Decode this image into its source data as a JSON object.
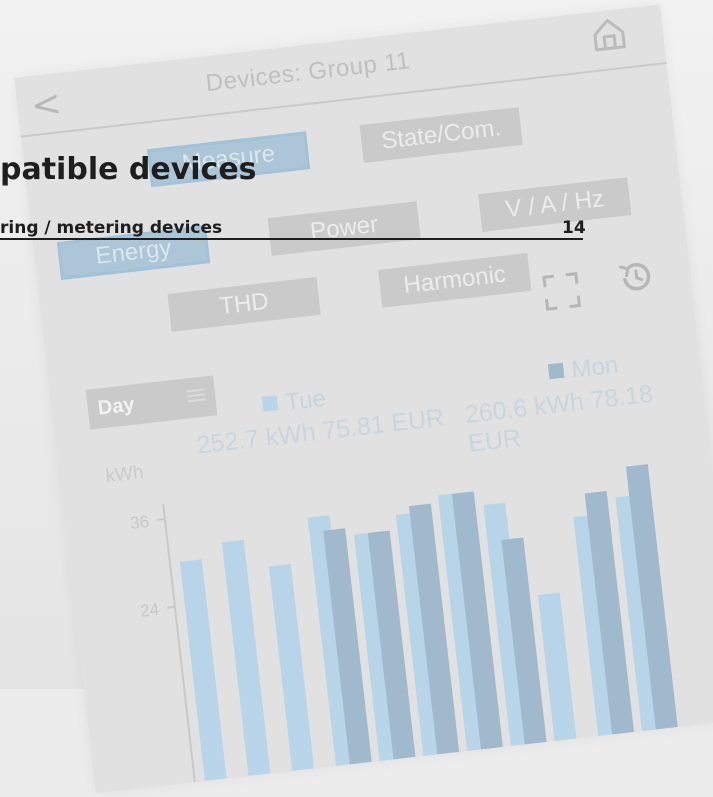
{
  "screen": {
    "title": "Devices: Group 11",
    "back_icon": "chevron-left-icon",
    "home_icon": "home-icon"
  },
  "categories": [
    {
      "label": "Measure",
      "active": true
    },
    {
      "label": "State/Com.",
      "active": false
    }
  ],
  "subtabs": [
    {
      "label": "Energy",
      "active": true
    },
    {
      "label": "Power",
      "active": false
    },
    {
      "label": "V / A / Hz",
      "active": false
    },
    {
      "label": "THD",
      "active": false
    },
    {
      "label": "Harmonic",
      "active": false
    }
  ],
  "period": {
    "label": "Day"
  },
  "legend": [
    {
      "label": "Tue",
      "color": "#b6d4e9",
      "summary": "252.7 kWh 75.81 EUR"
    },
    {
      "label": "Mon",
      "color": "#9db7cb",
      "summary": "260.6 kWh 78.18 EUR"
    }
  ],
  "chart_data": {
    "type": "bar",
    "ylabel": "kWh",
    "yticks": [
      36,
      24
    ],
    "series": [
      {
        "name": "Tue",
        "values": [
          30,
          32,
          28,
          34,
          31,
          33,
          35,
          33,
          20,
          30,
          32
        ]
      },
      {
        "name": "Mon",
        "values": [
          0,
          0,
          0,
          32,
          31,
          34,
          35,
          28,
          0,
          33,
          36
        ]
      }
    ]
  },
  "doc": {
    "title": "patible devices",
    "subtitle": "ring / metering devices",
    "page": "14"
  }
}
